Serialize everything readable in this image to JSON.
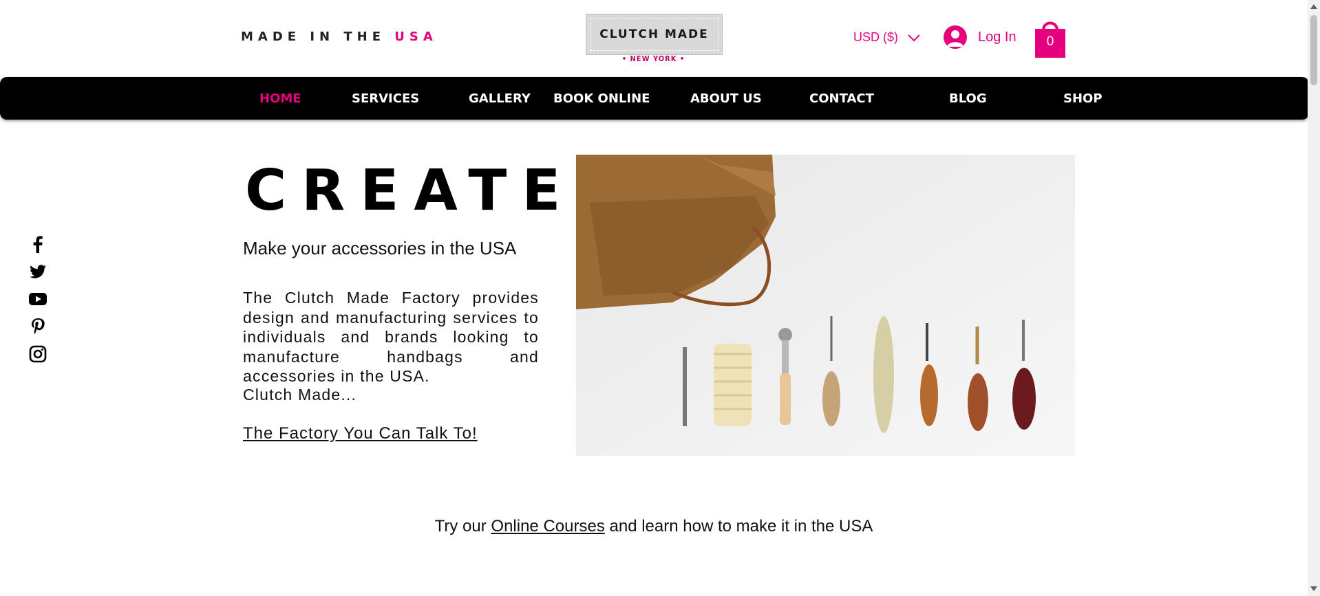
{
  "header": {
    "tagline_prefix": "MADE IN THE",
    "tagline_accent": "USA",
    "logo_text": "CLUTCH MADE",
    "logo_subtext": "• NEW YORK •",
    "currency": "USD ($)",
    "login_label": "Log In",
    "cart_count": "0"
  },
  "nav": {
    "items": [
      {
        "label": "HOME",
        "active": true
      },
      {
        "label": "SERVICES"
      },
      {
        "label": "GALLERY"
      },
      {
        "label": "BOOK ONLINE"
      },
      {
        "label": "ABOUT US"
      },
      {
        "label": "CONTACT"
      },
      {
        "label": "BLOG"
      },
      {
        "label": "SHOP"
      }
    ]
  },
  "social": [
    "facebook-icon",
    "twitter-icon",
    "youtube-icon",
    "pinterest-icon",
    "instagram-icon"
  ],
  "hero": {
    "title": "CREATE",
    "subtitle": "Make your accessories in the USA",
    "body": "The Clutch Made Factory provides design and manufacturing services to individuals and brands looking to manufacture handbags and accessories in the USA.",
    "tail": "Clutch Made...",
    "link": "The Factory You Can Talk To!"
  },
  "courses": {
    "prefix": "Try our",
    "link": "Online Courses",
    "suffix": "and learn how to make it in the USA"
  },
  "colors": {
    "accent": "#e6007e",
    "nav_bg": "#000000"
  }
}
